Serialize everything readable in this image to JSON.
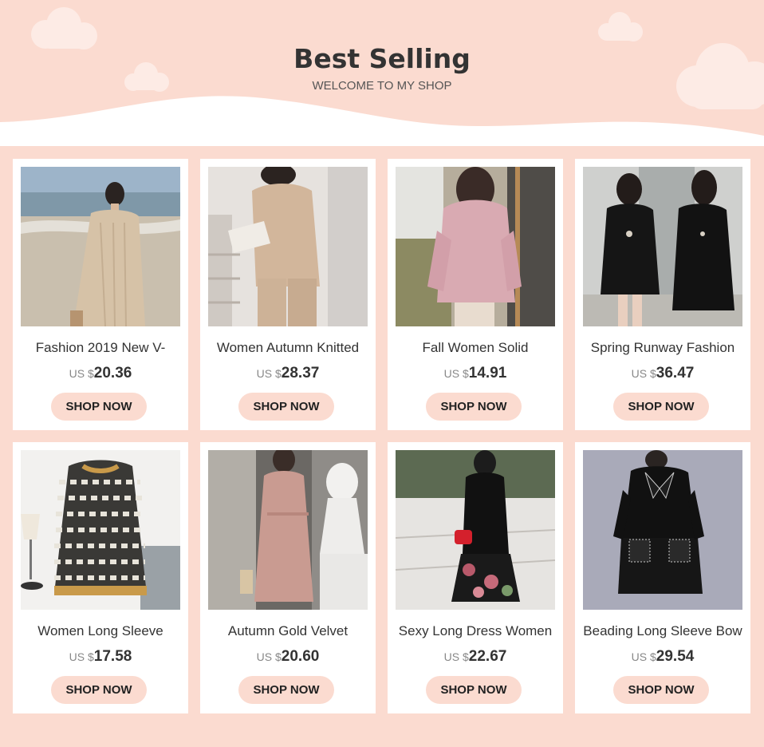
{
  "header": {
    "title": "Best Selling",
    "subtitle": "WELCOME TO MY SHOP"
  },
  "colors": {
    "background": "#fbdbd0",
    "cloud": "#fdebe5",
    "button": "#fbdbd0",
    "card": "#ffffff"
  },
  "products": [
    {
      "name": "Fashion 2019 New V-",
      "currency": "US $",
      "price": "20.36",
      "button": "SHOP NOW",
      "image": "beige-knit-dress-beach-photo"
    },
    {
      "name": "Women Autumn Knitted",
      "currency": "US $",
      "price": "28.37",
      "button": "SHOP NOW",
      "image": "beige-knit-set-reading-photo"
    },
    {
      "name": "Fall Women Solid",
      "currency": "US $",
      "price": "14.91",
      "button": "SHOP NOW",
      "image": "pink-turtleneck-sweater-photo"
    },
    {
      "name": "Spring Runway Fashion",
      "currency": "US $",
      "price": "36.47",
      "button": "SHOP NOW",
      "image": "black-cape-coat-photo"
    },
    {
      "name": "Women Long Sleeve",
      "currency": "US $",
      "price": "17.58",
      "button": "SHOP NOW",
      "image": "chevron-knit-sweater-photo"
    },
    {
      "name": "Autumn Gold Velvet",
      "currency": "US $",
      "price": "20.60",
      "button": "SHOP NOW",
      "image": "pink-velvet-wrap-dress-photo"
    },
    {
      "name": "Sexy Long Dress Women",
      "currency": "US $",
      "price": "22.67",
      "button": "SHOP NOW",
      "image": "black-floral-maxi-dress-photo"
    },
    {
      "name": "Beading Long Sleeve Bow",
      "currency": "US $",
      "price": "29.54",
      "button": "SHOP NOW",
      "image": "black-bow-dress-photo"
    }
  ]
}
